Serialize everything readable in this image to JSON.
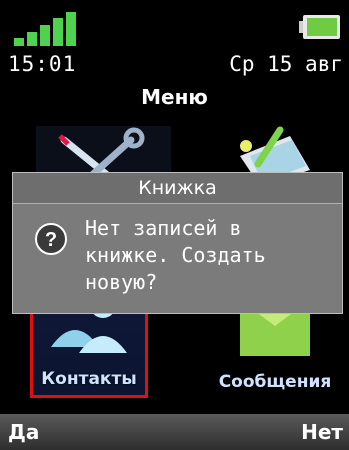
{
  "status": {
    "time": "15:01",
    "date": "Ср 15 авг",
    "signal_icon": "signal-bars-icon",
    "battery_icon": "battery-full-icon",
    "signal_color": "#4fd24f",
    "battery_color": "#7bd64a"
  },
  "menu": {
    "title": "Меню",
    "items": [
      {
        "label": "",
        "icon": "settings-tools-icon"
      },
      {
        "label": "",
        "icon": "organizer-notes-icon"
      },
      {
        "label": "Контакты",
        "icon": "contacts-people-icon",
        "selected": true
      },
      {
        "label": "Сообщения",
        "icon": "messages-envelope-icon"
      }
    ]
  },
  "dialog": {
    "title": "Книжка",
    "icon": "question-icon",
    "message": "Нет записей в\nкнижке. Создать\nновую?"
  },
  "softkeys": {
    "left": "Да",
    "right": "Нет"
  }
}
